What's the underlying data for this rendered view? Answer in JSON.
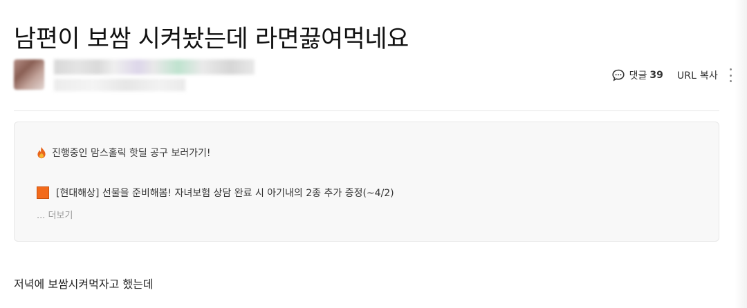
{
  "post": {
    "title": "남편이 보쌈 시켜놨는데 라면끓여먹네요",
    "body_first_line": "저녁에 보쌈시켜먹자고 했는데"
  },
  "actions": {
    "comment_label": "댓글",
    "comment_count": "39",
    "url_copy_label": "URL 복사",
    "comment_icon": "speech-bubble-icon",
    "more_icon": "vertical-dots-icon"
  },
  "notice": {
    "item1": {
      "icon": "fire-icon",
      "text": "진행중인 맘스홀릭 핫딜 공구 보러가기!"
    },
    "item2": {
      "icon": "orange-square-icon",
      "text": "[현대해상] 선물을 준비해봄! 자녀보험 상담 완료 시 아기내의 2종 추가 증정(~4/2)"
    },
    "more_label": "... 더보기"
  },
  "colors": {
    "notice_bg": "#f8f8f8",
    "square_icon": "#f26a1b",
    "fire": "#e8641b"
  }
}
